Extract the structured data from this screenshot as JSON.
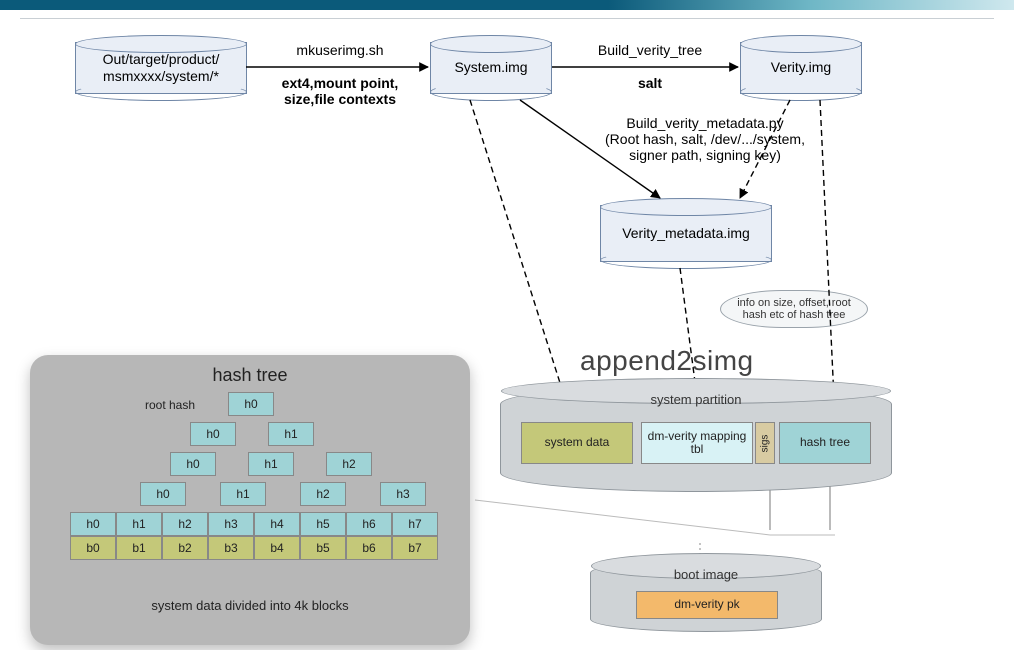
{
  "nodes": {
    "source": {
      "line1": "Out/target/product/",
      "line2": "msmxxxx/system/*"
    },
    "system": "System.img",
    "verity": "Verity.img",
    "metadata": "Verity_metadata.img"
  },
  "edges": {
    "mkuserimg": {
      "top": "mkuserimg.sh",
      "bottom": "ext4,mount point, size,file contexts"
    },
    "buildtree": {
      "top": "Build_verity_tree",
      "bottom": "salt"
    },
    "buildmeta": {
      "line1": "Build_verity_metadata.py",
      "line2": "(Root hash, salt, /dev/.../system,",
      "line3": "signer path, signing key)"
    }
  },
  "append2": "append2simg",
  "bubble": "info on size, offset, root hash etc of hash tree",
  "panel": {
    "title": "hash tree",
    "root_label": "root hash",
    "caption": "system data divided into 4k blocks",
    "rows": [
      [
        "h0"
      ],
      [
        "h0",
        "h1"
      ],
      [
        "h0",
        "h1",
        "h2"
      ],
      [
        "h0",
        "h1",
        "h2",
        "h3"
      ],
      [
        "h0",
        "h1",
        "h2",
        "h3",
        "h4",
        "h5",
        "h6",
        "h7"
      ],
      [
        "b0",
        "b1",
        "b2",
        "b3",
        "b4",
        "b5",
        "b6",
        "b7"
      ]
    ]
  },
  "syspart": {
    "title": "system partition",
    "slots": {
      "sys": "system data",
      "map": "dm-verity mapping tbl",
      "sigs": "sigs",
      "hash": "hash tree"
    }
  },
  "boot": {
    "title": "boot image",
    "pk": "dm-verity pk"
  }
}
